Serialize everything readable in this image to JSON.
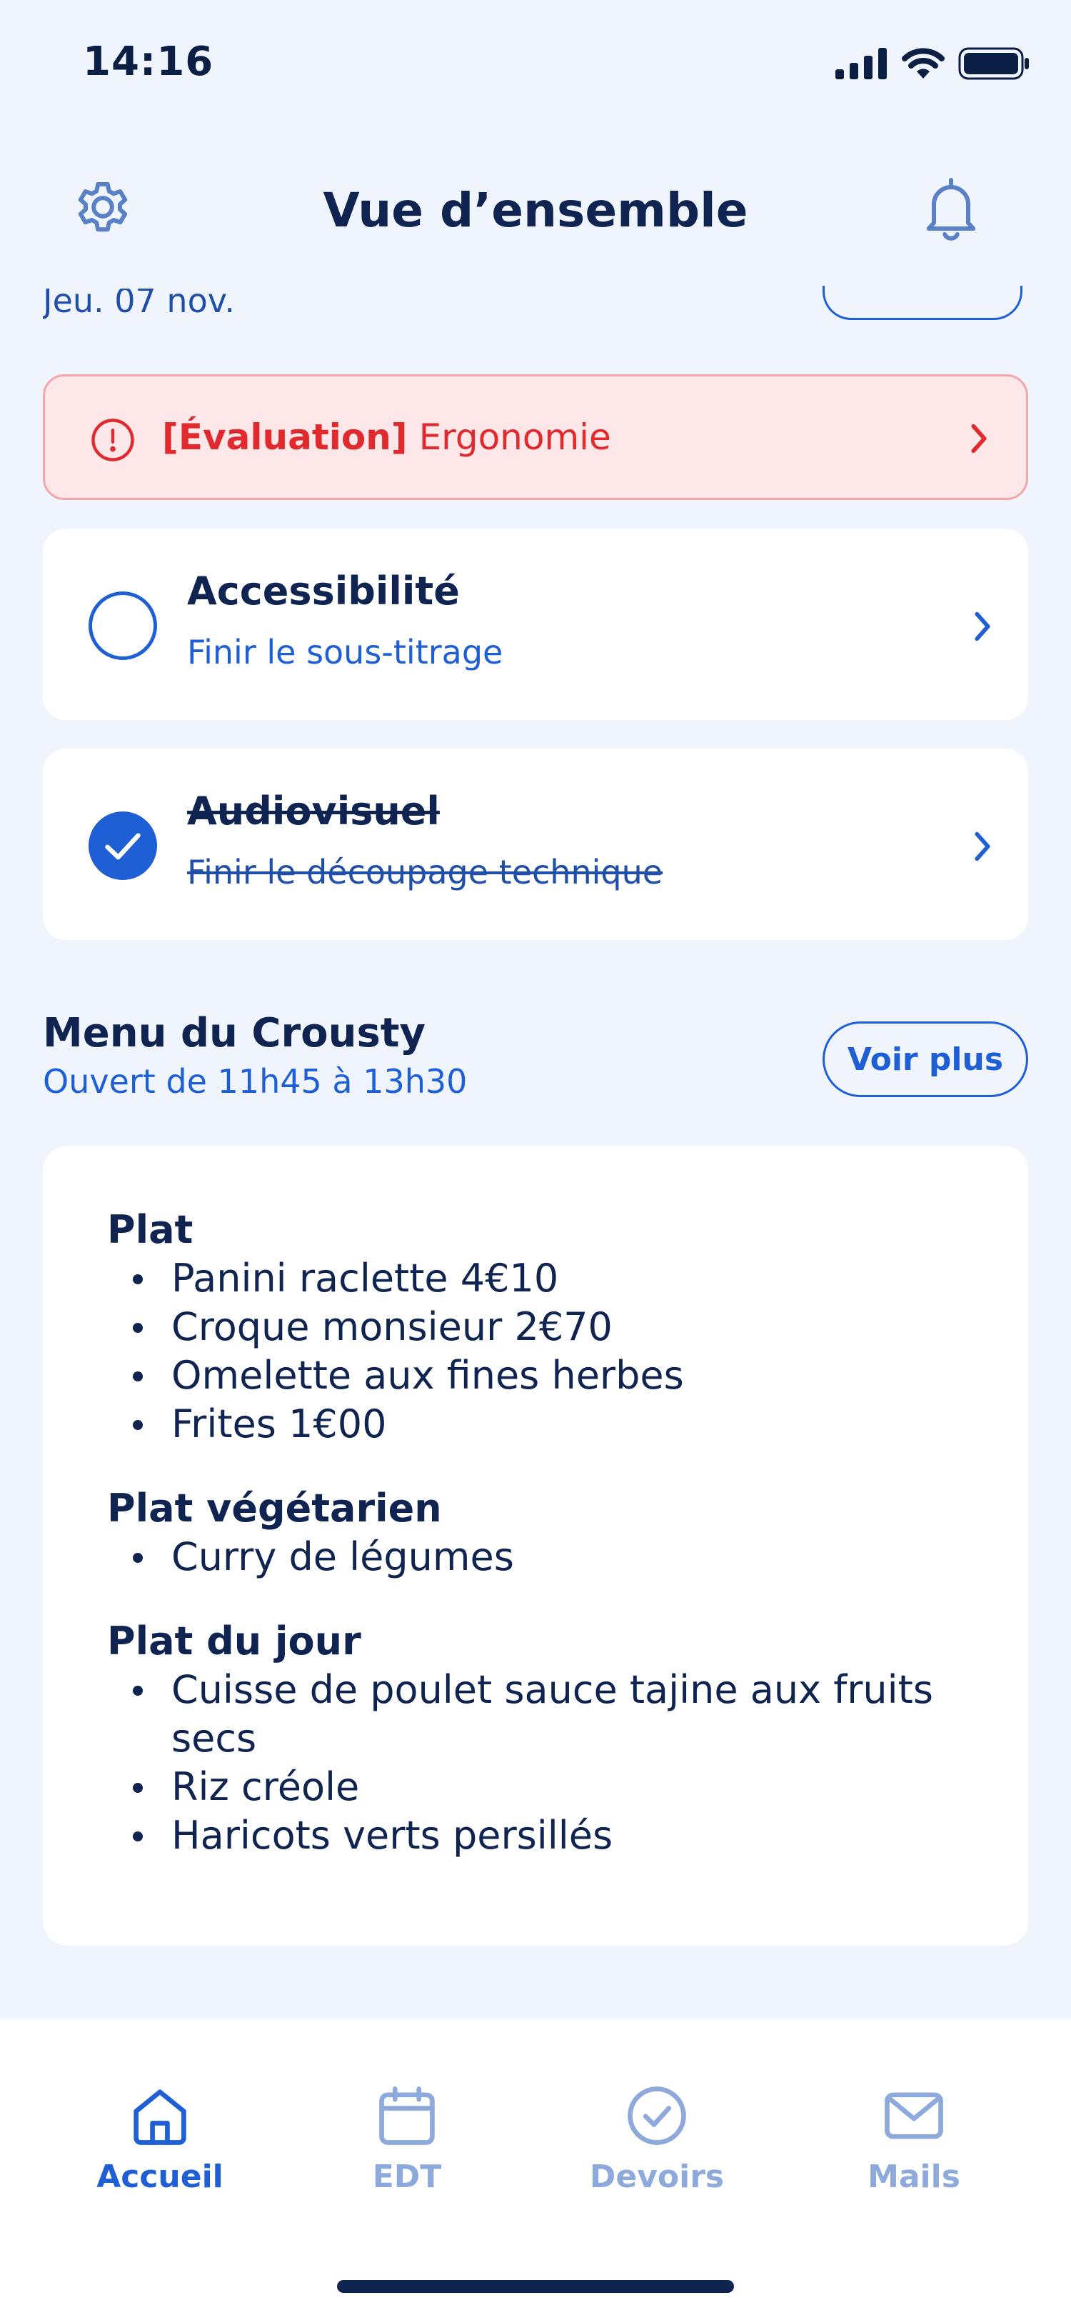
{
  "status_bar": {
    "time": "14:16"
  },
  "header": {
    "title": "Vue d’ensemble"
  },
  "partial_date": "Jeu. 07 nov.",
  "alert": {
    "tag": "[Évaluation]",
    "subject": "Ergonomie",
    "color": "#E02A2E"
  },
  "tasks": [
    {
      "title": "Accessibilité",
      "subtitle": "Finir le sous-titrage",
      "done": false
    },
    {
      "title": "Audiovisuel",
      "subtitle": "Finir le découpage technique",
      "done": true
    }
  ],
  "menu": {
    "title": "Menu du Crousty",
    "hours": "Ouvert de 11h45 à 13h30",
    "more_label": "Voir plus",
    "sections": [
      {
        "title": "Plat",
        "items": [
          "Panini raclette 4€10",
          "Croque monsieur 2€70",
          "Omelette aux fines herbes",
          "Frites 1€00"
        ]
      },
      {
        "title": "Plat végétarien",
        "items": [
          "Curry de légumes"
        ]
      },
      {
        "title": "Plat du jour",
        "items": [
          "Cuisse de poulet sauce tajine aux fruits secs",
          "Riz créole",
          "Haricots verts persillés"
        ]
      }
    ]
  },
  "tabs": [
    {
      "label": "Accueil",
      "icon": "home-icon",
      "active": true
    },
    {
      "label": "EDT",
      "icon": "calendar-icon",
      "active": false
    },
    {
      "label": "Devoirs",
      "icon": "check-circle-icon",
      "active": false
    },
    {
      "label": "Mails",
      "icon": "mail-icon",
      "active": false
    }
  ],
  "colors": {
    "accent": "#1F5FD6",
    "text": "#0F2450",
    "background": "#F0F5FD",
    "inactive_tab": "#8EA9DB"
  }
}
